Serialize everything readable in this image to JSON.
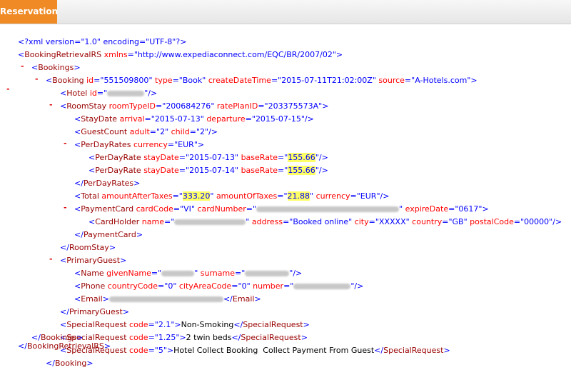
{
  "tab": {
    "label": "Reservation"
  },
  "xml": {
    "decl": "<?xml version=\"1.0\" encoding=\"UTF-8\"?>",
    "root": {
      "tag": "BookingRetrievalRS",
      "xmlns": "http://www.expediaconnect.com/EQC/BR/2007/02"
    },
    "bookings_tag": "Bookings",
    "booking": {
      "tag": "Booking",
      "id": "551509800",
      "type": "Book",
      "createDateTime": "2015-07-11T21:02:00Z",
      "source": "A-Hotels.com"
    },
    "hotel_tag": "Hotel",
    "roomstay": {
      "tag": "RoomStay",
      "roomTypeID": "200684276",
      "ratePlanID": "203375573A"
    },
    "staydate": {
      "tag": "StayDate",
      "arrival": "2015-07-13",
      "departure": "2015-07-15"
    },
    "guestcount": {
      "tag": "GuestCount",
      "adult": "2",
      "child": "2"
    },
    "perdayrates": {
      "tag": "PerDayRates",
      "currency": "EUR"
    },
    "rates": [
      {
        "tag": "PerDayRate",
        "stayDate": "2015-07-13",
        "baseRate": "155.66"
      },
      {
        "tag": "PerDayRate",
        "stayDate": "2015-07-14",
        "baseRate": "155.66"
      }
    ],
    "total": {
      "tag": "Total",
      "amountAfterTaxes": "333.20",
      "amountOfTaxes": "21.88",
      "currency": "EUR"
    },
    "paymentcard": {
      "tag": "PaymentCard",
      "expireDate": "0617",
      "cardCode": "VI"
    },
    "cardholder": {
      "tag": "CardHolder",
      "address": "Booked online",
      "city": "XXXXX",
      "country": "GB",
      "postalCode": "00000"
    },
    "primaryguest_tag": "PrimaryGuest",
    "name_tag": "Name",
    "phone": {
      "tag": "Phone",
      "countryCode": "0",
      "cityAreaCode": "0"
    },
    "email_tag": "Email",
    "specialrequests": [
      {
        "tag": "SpecialRequest",
        "code": "2.1",
        "text": "Non-Smoking"
      },
      {
        "tag": "SpecialRequest",
        "code": "1.25",
        "text": "2 twin beds"
      },
      {
        "tag": "SpecialRequest",
        "code": "5",
        "text": "Hotel Collect Booking  Collect Payment From Guest"
      }
    ],
    "toggle_symbol": "-",
    "attr_names": {
      "version": "version",
      "encoding": "encoding",
      "xmlns": "xmlns",
      "id": "id",
      "type": "type",
      "createDateTime": "createDateTime",
      "source": "source",
      "roomTypeID": "roomTypeID",
      "ratePlanID": "ratePlanID",
      "arrival": "arrival",
      "departure": "departure",
      "adult": "adult",
      "child": "child",
      "currency": "currency",
      "stayDate": "stayDate",
      "baseRate": "baseRate",
      "amountAfterTaxes": "amountAfterTaxes",
      "amountOfTaxes": "amountOfTaxes",
      "cardCode": "cardCode",
      "cardNumber": "cardNumber",
      "expireDate": "expireDate",
      "name": "name",
      "address": "address",
      "city": "city",
      "country": "country",
      "postalCode": "postalCode",
      "givenName": "givenName",
      "surname": "surname",
      "countryCode": "countryCode",
      "cityAreaCode": "cityAreaCode",
      "number": "number",
      "code": "code"
    }
  }
}
